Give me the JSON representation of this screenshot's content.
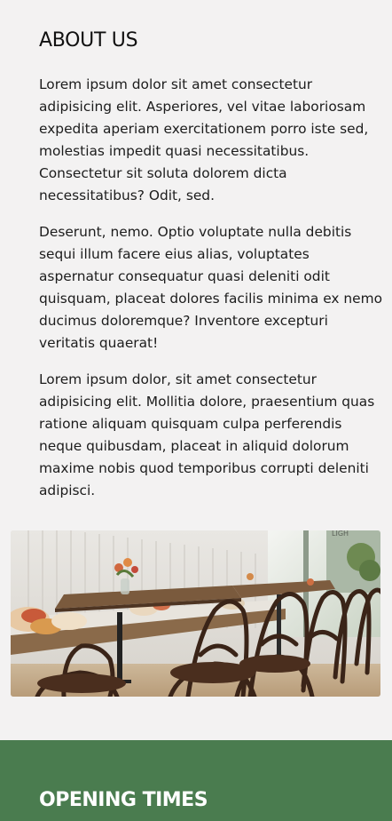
{
  "about": {
    "title": "ABOUT US",
    "paragraphs": [
      "Lorem ipsum dolor sit amet consectetur adipisicing elit. Asperiores, vel vitae laboriosam expedita aperiam exercitationem porro iste sed, molestias impedit quasi necessitatibus. Consectetur sit soluta dolorem dicta necessitatibus? Odit, sed.",
      "Deserunt, nemo. Optio voluptate nulla debitis sequi illum facere eius alias, voluptates aspernatur consequatur quasi deleniti odit quisquam, placeat dolores facilis minima ex nemo ducimus doloremque? Inventore excepturi veritatis quaerat!",
      "Lorem ipsum dolor, sit amet consectetur adipisicing elit. Mollitia dolore, praesentium quas ratione aliquam quisquam culpa perferendis neque quibusdam, placeat in aliquid dolorum maxime nobis quod temporibus corrupti deleniti adipisci."
    ],
    "image": {
      "subject": "cafe-interior-photo"
    }
  },
  "opening": {
    "title": "OPENING TIMES"
  },
  "colors": {
    "page_background": "#f3f2f2",
    "section_green": "#4a7c4f",
    "text": "#1c1c1c",
    "heading_on_green": "#ffffff"
  }
}
